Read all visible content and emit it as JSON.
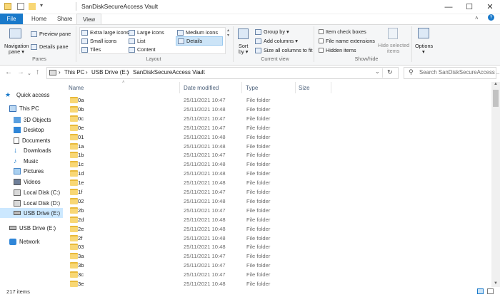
{
  "window": {
    "title": "SanDiskSecureAccess Vault",
    "minimize": "—",
    "maximize": "☐",
    "close": "✕"
  },
  "tabs": [
    {
      "label": "File"
    },
    {
      "label": "Home"
    },
    {
      "label": "Share"
    },
    {
      "label": "View"
    }
  ],
  "ribbon": {
    "panes": {
      "navigation_pane": "Navigation",
      "navigation_pane2": "pane ▾",
      "preview_pane": "Preview pane",
      "details_pane": "Details pane",
      "group": "Panes"
    },
    "layout": {
      "items": [
        "Extra large icons",
        "Large icons",
        "Medium icons",
        "Small icons",
        "List",
        "Details",
        "Tiles",
        "Content"
      ],
      "group": "Layout"
    },
    "current_view": {
      "sort": "Sort",
      "sort2": "by ▾",
      "group_by": "Group by ▾",
      "add_columns": "Add columns ▾",
      "size_all": "Size all columns to fit",
      "group": "Current view"
    },
    "show_hide": {
      "item_check_boxes": "Item check boxes",
      "file_name_extensions": "File name extensions",
      "hidden_items": "Hidden items",
      "hide_selected": "Hide selected",
      "hide_selected2": "items",
      "options": "Options",
      "options2": "▾",
      "group": "Show/hide"
    }
  },
  "address": {
    "crumbs": [
      "This PC",
      "USB Drive (E:)",
      "SanDiskSecureAccess Vault"
    ],
    "search_placeholder": "Search SanDiskSecureAccess ..."
  },
  "nav_pane": {
    "items": [
      {
        "label": "Quick access"
      },
      {
        "label": "This PC"
      },
      {
        "label": "3D Objects"
      },
      {
        "label": "Desktop"
      },
      {
        "label": "Documents"
      },
      {
        "label": "Downloads"
      },
      {
        "label": "Music"
      },
      {
        "label": "Pictures"
      },
      {
        "label": "Videos"
      },
      {
        "label": "Local Disk (C:)"
      },
      {
        "label": "Local Disk (D:)"
      },
      {
        "label": "USB Drive (E:)"
      },
      {
        "label": "USB Drive (E:)"
      },
      {
        "label": "Network"
      }
    ]
  },
  "columns": [
    "Name",
    "Date modified",
    "Type",
    "Size"
  ],
  "files": [
    {
      "name": "0a",
      "date": "25/11/2021 10:47",
      "type": "File folder"
    },
    {
      "name": "0b",
      "date": "25/11/2021 10:48",
      "type": "File folder"
    },
    {
      "name": "0c",
      "date": "25/11/2021 10:47",
      "type": "File folder"
    },
    {
      "name": "0e",
      "date": "25/11/2021 10:47",
      "type": "File folder"
    },
    {
      "name": "01",
      "date": "25/11/2021 10:48",
      "type": "File folder"
    },
    {
      "name": "1a",
      "date": "25/11/2021 10:48",
      "type": "File folder"
    },
    {
      "name": "1b",
      "date": "25/11/2021 10:47",
      "type": "File folder"
    },
    {
      "name": "1c",
      "date": "25/11/2021 10:48",
      "type": "File folder"
    },
    {
      "name": "1d",
      "date": "25/11/2021 10:48",
      "type": "File folder"
    },
    {
      "name": "1e",
      "date": "25/11/2021 10:48",
      "type": "File folder"
    },
    {
      "name": "1f",
      "date": "25/11/2021 10:47",
      "type": "File folder"
    },
    {
      "name": "02",
      "date": "25/11/2021 10:48",
      "type": "File folder"
    },
    {
      "name": "2b",
      "date": "25/11/2021 10:47",
      "type": "File folder"
    },
    {
      "name": "2d",
      "date": "25/11/2021 10:48",
      "type": "File folder"
    },
    {
      "name": "2e",
      "date": "25/11/2021 10:48",
      "type": "File folder"
    },
    {
      "name": "2f",
      "date": "25/11/2021 10:48",
      "type": "File folder"
    },
    {
      "name": "03",
      "date": "25/11/2021 10:48",
      "type": "File folder"
    },
    {
      "name": "3a",
      "date": "25/11/2021 10:47",
      "type": "File folder"
    },
    {
      "name": "3b",
      "date": "25/11/2021 10:47",
      "type": "File folder"
    },
    {
      "name": "3c",
      "date": "25/11/2021 10:47",
      "type": "File folder"
    },
    {
      "name": "3e",
      "date": "25/11/2021 10:48",
      "type": "File folder"
    }
  ],
  "status": {
    "items": "217 items"
  },
  "colors": {
    "accent": "#1979ca",
    "folder": "#f8d775",
    "selection": "#cce8ff"
  },
  "icons": [
    "folder-icon",
    "back-arrow-icon",
    "forward-arrow-icon",
    "up-arrow-icon",
    "refresh-icon",
    "search-icon",
    "chevron-down-icon"
  ]
}
